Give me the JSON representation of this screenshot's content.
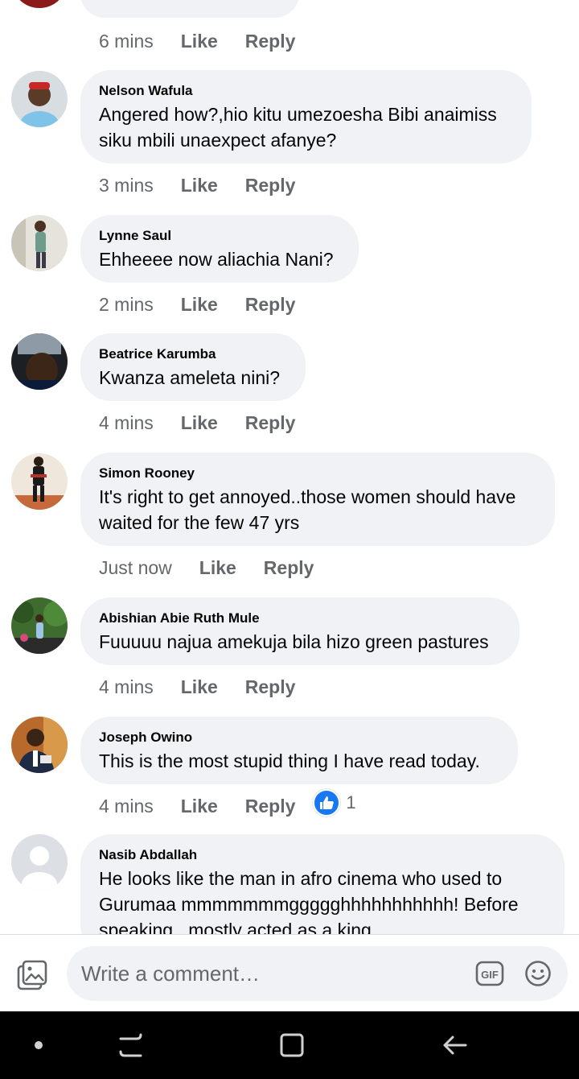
{
  "top_partial": {
    "time": "6 mins",
    "like": "Like",
    "reply": "Reply"
  },
  "comments": [
    {
      "author": "Nelson Wafula",
      "lines": [
        "Angered how?,hio kitu umezoesha Bibi anaimiss",
        "siku mbili unaexpect afanye?"
      ],
      "time": "3 mins",
      "like": "Like",
      "reply": "Reply"
    },
    {
      "author": "Lynne Saul",
      "lines": [
        "Ehheeee now aliachia Nani?"
      ],
      "time": "2 mins",
      "like": "Like",
      "reply": "Reply"
    },
    {
      "author": "Beatrice Karumba",
      "lines": [
        "Kwanza ameleta nini?"
      ],
      "time": "4 mins",
      "like": "Like",
      "reply": "Reply"
    },
    {
      "author": "Simon Rooney",
      "lines": [
        "It's right to get annoyed..those women should have",
        "waited for the few 47 yrs"
      ],
      "time": "Just now",
      "like": "Like",
      "reply": "Reply"
    },
    {
      "author": "Abishian Abie Ruth Mule",
      "lines": [
        "Fuuuuu najua amekuja bila hizo green pastures"
      ],
      "time": "4 mins",
      "like": "Like",
      "reply": "Reply"
    },
    {
      "author": "Joseph Owino",
      "lines": [
        "This is the most stupid thing I have read today."
      ],
      "time": "4 mins",
      "like": "Like",
      "reply": "Reply",
      "reactions": {
        "icon": "like-icon",
        "count": "1"
      }
    },
    {
      "author": "Nasib Abdallah",
      "lines": [
        "He looks like the man in afro cinema who used to",
        "Gurumaa mmmmmmmggggghhhhhhhhhhh! Before",
        "speaking...mostly acted as a king"
      ]
    }
  ],
  "composer": {
    "placeholder": "Write a comment…",
    "photo_icon": "photo-icon",
    "gif_icon": "gif-icon",
    "emoji_icon": "emoji-icon"
  },
  "navbar": {
    "icons": [
      "dot-icon",
      "recent-apps-icon",
      "home-icon",
      "back-icon"
    ]
  },
  "colors": {
    "accent": "#1877f2",
    "bubble": "#f0f2f5",
    "meta_text": "#65676b"
  }
}
